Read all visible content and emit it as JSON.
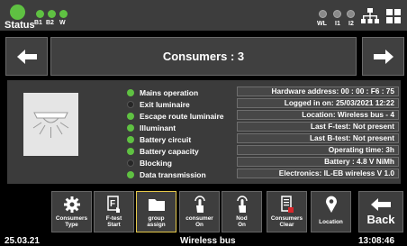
{
  "status_bar": {
    "status_label": "Status",
    "indicators": [
      {
        "label": "B1"
      },
      {
        "label": "B2"
      },
      {
        "label": "W"
      }
    ],
    "right_indicators": [
      {
        "label": "WL"
      },
      {
        "label": "I1"
      },
      {
        "label": "I2"
      }
    ],
    "icons": [
      "network-icon",
      "luminaires-icon"
    ]
  },
  "nav": {
    "title": "Consumers : 3",
    "prev_icon": "arrow-left-icon",
    "next_icon": "arrow-right-icon"
  },
  "status_items": [
    {
      "label": "Mains operation",
      "state": "on"
    },
    {
      "label": "Exit luminaire",
      "state": "off"
    },
    {
      "label": "Escape route luminaire",
      "state": "on"
    },
    {
      "label": "Illuminant",
      "state": "on"
    },
    {
      "label": "Battery circuit",
      "state": "on"
    },
    {
      "label": "Battery capacity",
      "state": "on"
    },
    {
      "label": "Blocking",
      "state": "off"
    },
    {
      "label": "Data transmission",
      "state": "on"
    }
  ],
  "info": [
    "Hardware address: 00 : 00 : F6 : 75",
    "Logged in on: 25/03/2021   12:22",
    "Location: Wireless bus - 4",
    "Last F-test: Not present",
    "Last B-test: Not present",
    "Operating time: 3h",
    "Battery : 4.8 V NiMh",
    "Electronics: IL-EB wireless  V 1.0"
  ],
  "toolbar": {
    "buttons": [
      {
        "label1": "Consumers",
        "label2": "Type",
        "icon": "gear-icon"
      },
      {
        "label1": "F-test",
        "label2": "Start",
        "icon": "f-test-icon"
      },
      {
        "label1": "group",
        "label2": "assign",
        "icon": "folder-icon",
        "selected": true
      },
      {
        "label1": "consumer",
        "label2": "On",
        "icon": "touch-icon"
      },
      {
        "label1": "Nod",
        "label2": "On",
        "icon": "touch-icon"
      },
      {
        "label1": "Consumers",
        "label2": "Clear",
        "icon": "clear-icon"
      },
      {
        "label1": "Location",
        "label2": "",
        "icon": "location-pin-icon"
      }
    ],
    "back_label": "Back"
  },
  "footer": {
    "date": "25.03.21",
    "center": "Wireless bus",
    "time": "13:08:46"
  },
  "colors": {
    "led_on": "#5fc142",
    "selected_border": "#e6c94a",
    "background": "#000000"
  }
}
